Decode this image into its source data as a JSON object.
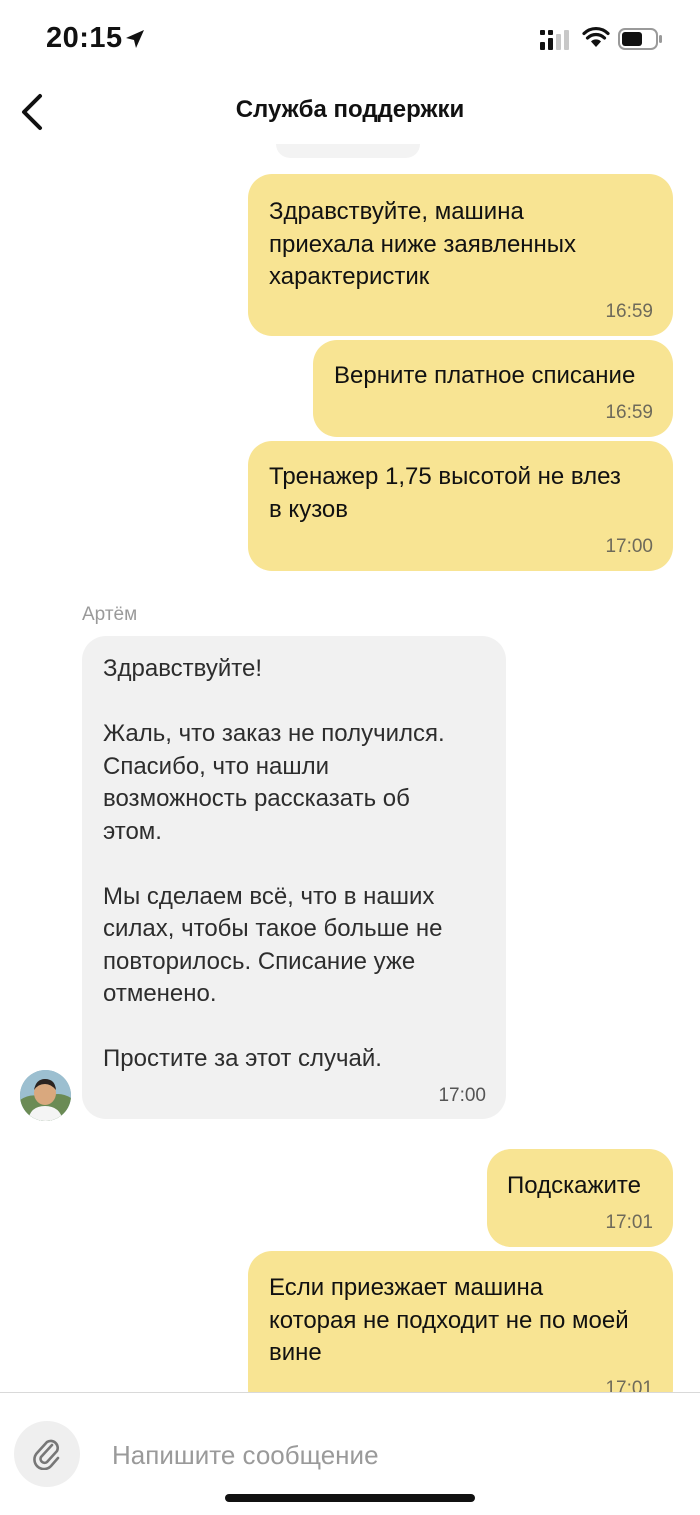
{
  "status_bar": {
    "time": "20:15"
  },
  "header": {
    "title": "Служба поддержки"
  },
  "messages": [
    {
      "direction": "out",
      "text": "Здравствуйте, машина\nприехала ниже заявленных\nхарактеристик",
      "time": "16:59"
    },
    {
      "direction": "out",
      "text": "Верните платное списание",
      "time": "16:59"
    },
    {
      "direction": "out",
      "text": "Тренажер 1,75 высотой не влез\nв кузов",
      "time": "17:00"
    },
    {
      "direction": "in",
      "sender": "Артём",
      "text": "Здравствуйте!\n\nЖаль, что заказ не получился.\nСпасибо, что нашли\nвозможность рассказать об\nэтом.\n\nМы сделаем всё, что в наших\nсилах, чтобы такое больше не\nповторилось. Списание уже\nотменено.\n\nПростите за этот случай.",
      "time": "17:00"
    },
    {
      "direction": "out",
      "text": "Подскажите",
      "time": "17:01"
    },
    {
      "direction": "out",
      "text": "Если приезжает машина\nкоторая не подходит не по моей\nвине",
      "time": "17:01"
    }
  ],
  "composer": {
    "placeholder": "Напишите сообщение"
  },
  "colors": {
    "outgoing_bubble": "#f8e493",
    "incoming_bubble": "#f1f1f1"
  }
}
